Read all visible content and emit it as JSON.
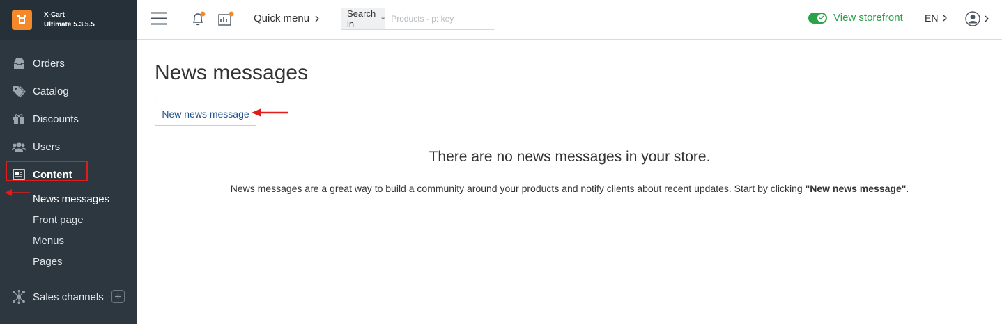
{
  "brand": {
    "name": "X-Cart",
    "edition": "Ultimate 5.3.5.5"
  },
  "sidebar": {
    "items": [
      {
        "label": "Orders",
        "icon": "inbox-icon"
      },
      {
        "label": "Catalog",
        "icon": "tags-icon"
      },
      {
        "label": "Discounts",
        "icon": "gift-icon"
      },
      {
        "label": "Users",
        "icon": "users-icon"
      },
      {
        "label": "Content",
        "icon": "newspaper-icon",
        "active": true
      }
    ],
    "sub_items": [
      "News messages",
      "Front page",
      "Menus",
      "Pages"
    ],
    "sales_channels": "Sales channels"
  },
  "header": {
    "quick_menu": "Quick menu",
    "search_in": "Search in",
    "search_placeholder": "Products - p: key",
    "storefront": "View storefront",
    "language": "EN"
  },
  "main": {
    "title": "News messages",
    "new_button": "New news message",
    "empty_title": "There are no news messages in your store.",
    "empty_desc_prefix": "News messages are a great way to build a community around your products and notify clients about recent updates. Start by clicking ",
    "empty_desc_bold": "\"New news message\"",
    "empty_desc_suffix": "."
  },
  "colors": {
    "sidebar_bg": "#2c3740",
    "accent_orange": "#f3892a",
    "storefront_green": "#29a34a",
    "annotation_red": "#e21b1b",
    "link_blue": "#1d4f8f"
  }
}
